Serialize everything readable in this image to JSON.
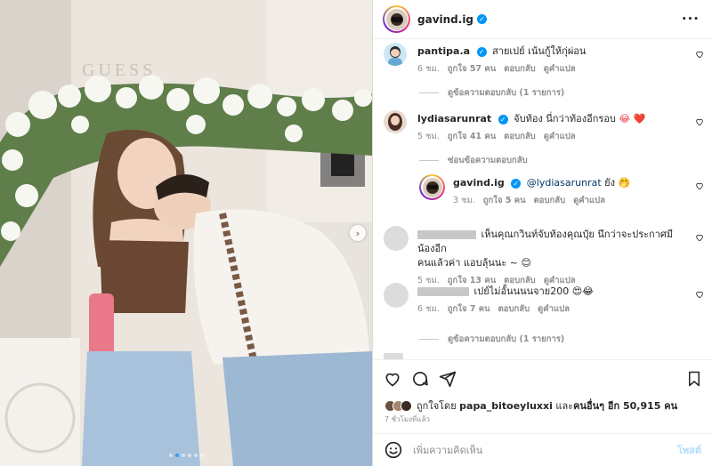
{
  "post": {
    "author": "gavind.ig",
    "likes_text_prefix": "ถูกใจโดย",
    "likes_first_user": "papa_bitoeyluxxi",
    "likes_joiner": "และ",
    "likes_others": "คนอื่นๆ อีก 50,915 คน",
    "time_ago": "7 ชั่วโมงที่แล้ว",
    "photo_sign": "GUESS",
    "carousel": {
      "total_dots": 6,
      "active_dot": 1
    }
  },
  "comments": [
    {
      "user": "pantipa.a",
      "verified": true,
      "text": "สายเปย์ เน้นกู้ให้กุ่ผ่อน",
      "time": "6 ชม.",
      "likes": "ถูกใจ 57 คน",
      "reply": "ตอบกลับ",
      "translate": "ดูคำแปล",
      "view_replies": "ดูข้อความตอบกลับ (1 รายการ)"
    },
    {
      "user": "lydiasarunrat",
      "verified": true,
      "text": "จับท้อง นี่กว่าท้องอีกรอบ",
      "emoji": "😂 ❤️",
      "time": "5 ชม.",
      "likes": "ถูกใจ 41 คน",
      "reply": "ตอบกลับ",
      "translate": "ดูคำแปล",
      "hide_replies": "ซ่อนข้อความตอบกลับ"
    },
    {
      "user": "gavind.ig",
      "verified": true,
      "mention": "@lydiasarunrat",
      "text": "ยัง",
      "emoji": "🤭",
      "time": "3 ชม.",
      "likes": "ถูกใจ 5 คน",
      "reply": "ตอบกลับ",
      "translate": "ดูคำแปล"
    },
    {
      "text_line1": "เห็นคุณกวินท์จับท้องคุณปุ๋ย นึกว่าจะประกาศมีน้องอีก",
      "text_line2": "คนแล้วค่า แอบลุ้นนะ ~",
      "emoji": "😊",
      "time": "5 ชม.",
      "likes": "ถูกใจ 13 คน",
      "reply": "ตอบกลับ",
      "translate": "ดูคำแปล"
    },
    {
      "text": "เปย์ไม่อั้นนนนจาย200",
      "emoji": "😍😂",
      "time": "6 ชม.",
      "likes": "ถูกใจ 7 คน",
      "reply": "ตอบกลับ",
      "translate": "ดูคำแปล",
      "view_replies": "ดูข้อความตอบกลับ (1 รายการ)"
    }
  ],
  "add_comment": {
    "placeholder": "เพิ่มความคิดเห็น",
    "post_label": "โพสต์"
  },
  "icons": [
    "heart-icon",
    "comment-icon",
    "share-icon",
    "bookmark-icon",
    "emoji-icon",
    "more-icon",
    "verified-icon"
  ],
  "colors": {
    "verified": "#0095f6",
    "mention": "#00376b",
    "heart": "#ed4956",
    "post_disabled": "#b2dffc",
    "muted": "#8e8e8e"
  }
}
